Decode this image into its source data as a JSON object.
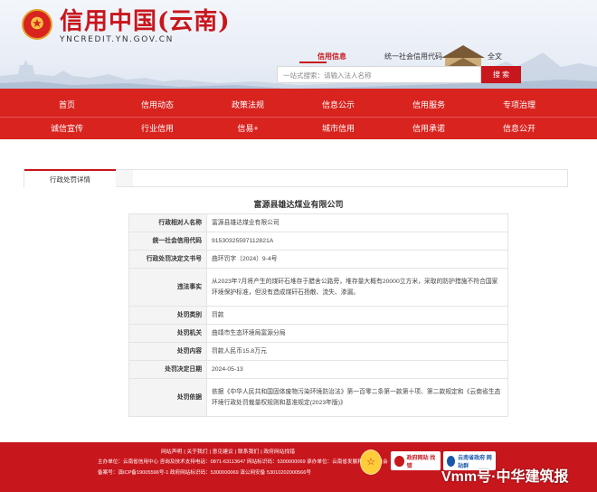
{
  "header": {
    "title": "信用中国(云南)",
    "url": "YNCREDIT.YN.GOV.CN",
    "search_tabs": [
      "信用信息",
      "统一社会信用代码",
      "全文"
    ],
    "search_placeholder": "一站式搜索：请输入法人名称",
    "search_button": "搜 索"
  },
  "nav": {
    "row1": [
      "首页",
      "信用动态",
      "政策法规",
      "信息公示",
      "信用服务",
      "专项治理"
    ],
    "row2": [
      "诚信宣传",
      "行业信用",
      "信易+",
      "城市信用",
      "信用承诺",
      "信息公开"
    ]
  },
  "detail": {
    "tab": "行政处罚详情",
    "company": "富源县雄达煤业有限公司",
    "rows": [
      {
        "label": "行政相对人名称",
        "value": "富源县雄达煤业有限公司"
      },
      {
        "label": "统一社会信用代码",
        "value": "91530325597112821A"
      },
      {
        "label": "行政处罚决定文书号",
        "value": "曲环罚字〔2024〕9-4号"
      },
      {
        "label": "违法事实",
        "value": "从2023年7月将产生的煤矸石堆存于腊舍公路旁，堆存量大概有20000立方米，采取的防护措施不符合国家环境保护标准，但没有造成煤矸石扬散、流失、渗漏。"
      },
      {
        "label": "处罚类别",
        "value": "罚款"
      },
      {
        "label": "处罚机关",
        "value": "曲靖市生态环境局富源分局"
      },
      {
        "label": "处罚内容",
        "value": "罚款人民币15.8万元"
      },
      {
        "label": "处罚决定日期",
        "value": "2024-05-13"
      },
      {
        "label": "处罚依据",
        "value": "依据《中华人民共和国固体废物污染环境防治法》第一百零二条第一款第十项、第二款规定和《云南省生态环境行政处罚裁量权规则和基准规定(2023年版)》"
      }
    ]
  },
  "footer": {
    "links": [
      "网站声明",
      "关于我们",
      "意见建议",
      "联系我们",
      "政府网站找错"
    ],
    "line1": "主办单位：云南省信用中心  咨询及技术支持电话：0871-63113647  网站标识码：5300000069  承办单位：云南省发展和改革委员会",
    "line2": "备案号：滇ICP备19005596号-1  政府网站标识码：5300000069  滇公网安备 53010202000566号",
    "card1": "政府网站 找错",
    "card2": "云南省政府 网站群"
  },
  "watermark": "Vmm号·中华建筑报"
}
